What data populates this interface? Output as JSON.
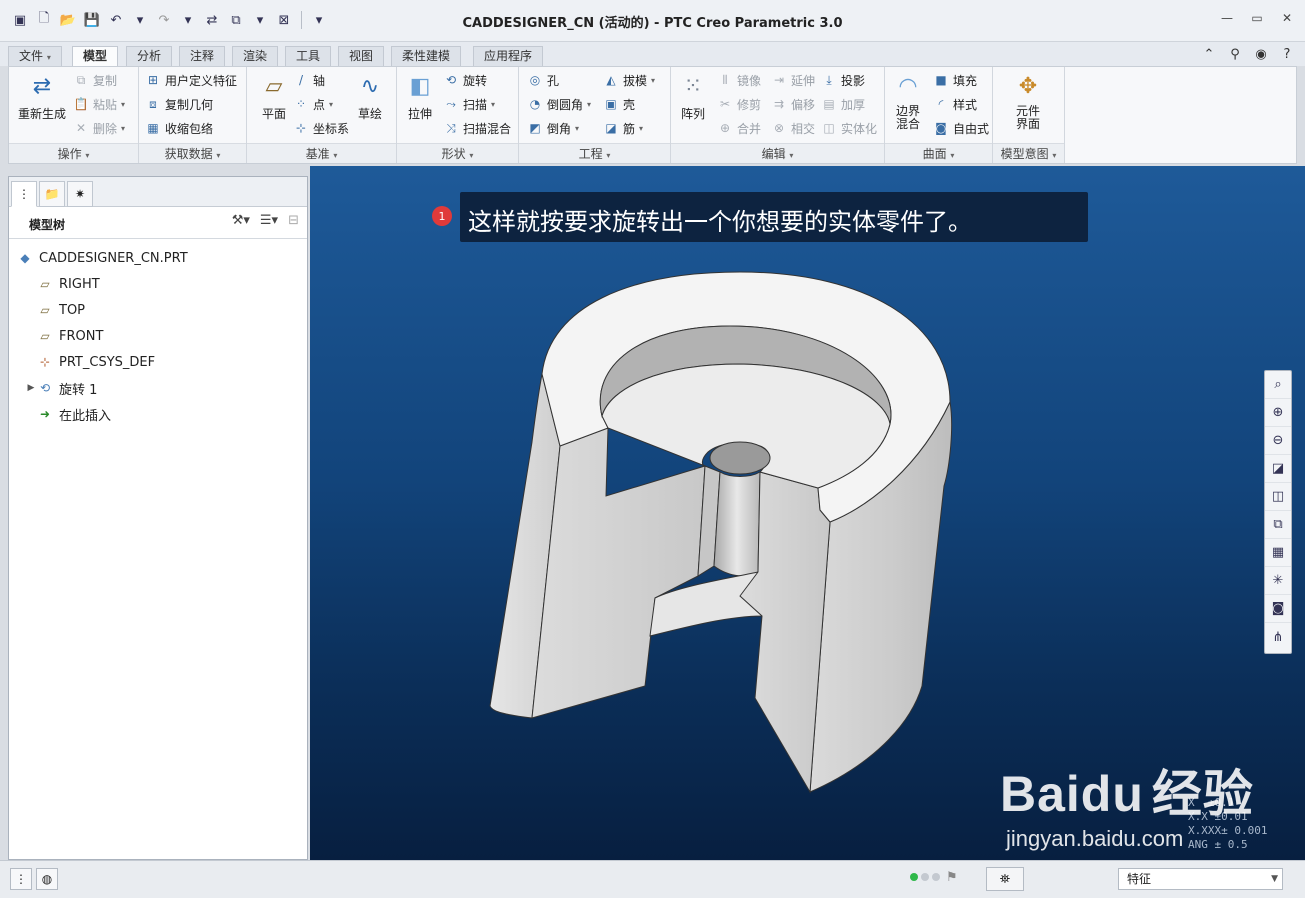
{
  "window": {
    "title": "CADDESIGNER_CN (活动的) - PTC Creo Parametric 3.0"
  },
  "tabs": [
    "文件",
    "模型",
    "分析",
    "注释",
    "渲染",
    "工具",
    "视图",
    "柔性建模",
    "应用程序"
  ],
  "ribbon": {
    "operations": {
      "label": "操作",
      "regen": "重新生成",
      "copy": "复制",
      "paste": "粘贴",
      "delete": "删除"
    },
    "getdata": {
      "label": "获取数据",
      "udf": "用户定义特征",
      "copygeom": "复制几何",
      "shrinkwrap": "收缩包络"
    },
    "datum": {
      "label": "基准",
      "plane": "平面",
      "axis": "轴",
      "point": "点",
      "csys": "坐标系",
      "sketch": "草绘"
    },
    "shapes": {
      "label": "形状",
      "extrude": "拉伸",
      "revolve": "旋转",
      "sweep": "扫描",
      "sweptblend": "扫描混合"
    },
    "engineering": {
      "label": "工程",
      "hole": "孔",
      "round": "倒圆角",
      "chamfer": "倒角",
      "draft": "拔模",
      "shell": "壳",
      "rib": "筋"
    },
    "editing": {
      "label": "编辑",
      "pattern": "阵列",
      "mirror": "镜像",
      "trim": "修剪",
      "merge": "合并",
      "extend": "延伸",
      "offset": "偏移",
      "intersect": "相交",
      "project": "投影",
      "thicken": "加厚",
      "solidify": "实体化"
    },
    "surfaces": {
      "label": "曲面",
      "boundary": "边界混合",
      "fill": "填充",
      "style": "样式",
      "freestyle": "自由式"
    },
    "intent": {
      "label": "模型意图",
      "component": "元件界面"
    }
  },
  "model_tree": {
    "header": "模型树",
    "nodes": [
      "CADDESIGNER_CN.PRT",
      "RIGHT",
      "TOP",
      "FRONT",
      "PRT_CSYS_DEF",
      "旋转 1",
      "在此插入"
    ]
  },
  "graphics": {
    "note_number": "1",
    "note_text": "这样就按要求旋转出一个你想要的实体零件了。",
    "tolerances": [
      "X  ±0.1",
      "X.X ±0.01",
      "X.XXX± 0.001",
      "ANG ± 0.5"
    ],
    "watermark_brand": "Baidu",
    "watermark_service": "经验",
    "watermark_url": "jingyan.baidu.com"
  },
  "status": {
    "filter_value": "特征"
  },
  "colors": {
    "accent": "#3a6ea5",
    "viewport_top": "#1e5a99",
    "viewport_bottom": "#071f40",
    "note_bg": "#0d2340",
    "badge": "#e03a3a",
    "status_light": "#2fb84a"
  }
}
